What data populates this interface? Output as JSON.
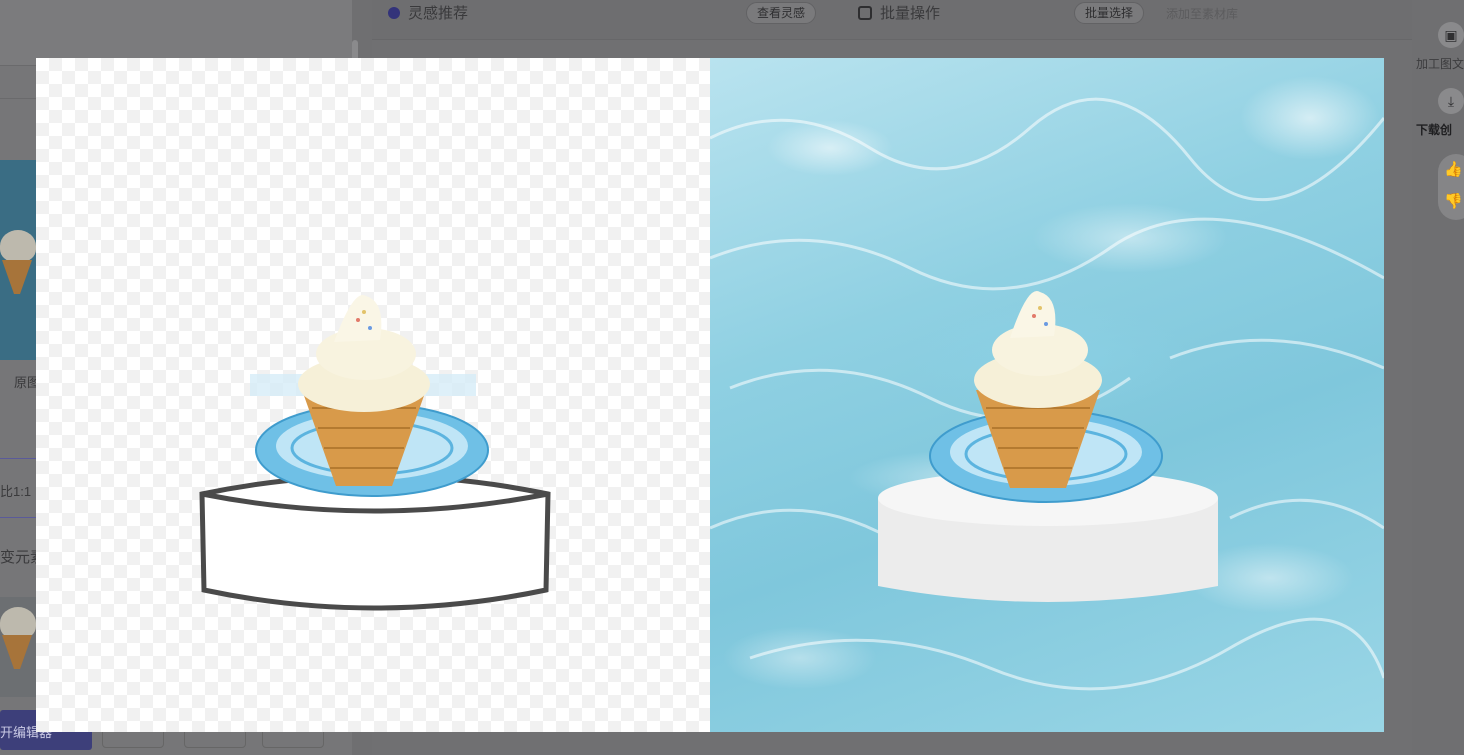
{
  "background_app": {
    "topbar": {
      "inspiration_title": "灵感推荐",
      "view_inspiration": "查看灵感",
      "batch_operation": "批量操作",
      "batch_select": "批量选择",
      "add_to_library": "添加至素材库"
    },
    "left_panel": {
      "original_label": "原图",
      "ratio_label": "比1:1",
      "element_label": "变元素",
      "edit_button": "开编辑器"
    }
  },
  "rail": {
    "process_label": "加工图文",
    "download_label": "下载创",
    "thumbs_up_icon": "thumbs-up-icon",
    "thumbs_down_icon": "thumbs-down-icon"
  },
  "preview": {
    "left_pane": "original-cutout",
    "right_pane": "generated-result"
  },
  "colors": {
    "overlay": "#6f6f71",
    "water": "#8fd0e2",
    "plate": "#6fc0e6",
    "cone": "#d89a4a",
    "cream": "#f6f0d8"
  }
}
